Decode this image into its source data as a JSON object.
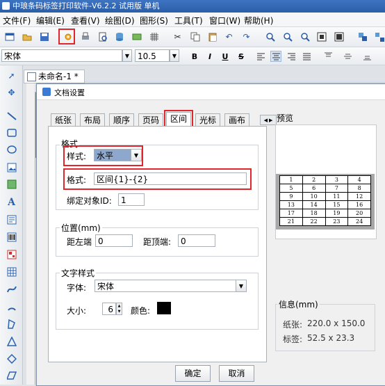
{
  "window": {
    "title": "中琅条码标签打印软件-V6.2.2 试用版 单机"
  },
  "menu": [
    "文件(F)",
    "编辑(E)",
    "查看(V)",
    "绘图(D)",
    "图形(S)",
    "工具(T)",
    "窗口(W)",
    "帮助(H)"
  ],
  "format_bar": {
    "font": "宋体",
    "size": "10.5",
    "bold": "B",
    "italic": "I",
    "underline": "U",
    "strike": "S"
  },
  "left_tools": {
    "text_tool": "A"
  },
  "document_tab": {
    "label": "未命名-1 *"
  },
  "dialog": {
    "title": "文档设置",
    "tabs": [
      "纸张",
      "布局",
      "顺序",
      "页码",
      "区间",
      "光标",
      "画布"
    ],
    "selected_tab": "区间",
    "format_group": {
      "title": "格式",
      "style_label": "样式:",
      "style_value": "水平",
      "format_label": "格式:",
      "format_value": "区间{1}-{2}",
      "bind_label": "绑定对象ID:",
      "bind_value": "1"
    },
    "position_group": {
      "title": "位置(mm)",
      "left_label": "距左端",
      "left_value": "0",
      "top_label": "距顶端:",
      "top_value": "0"
    },
    "text_style_group": {
      "title": "文字样式",
      "font_label": "字体:",
      "font_value": "宋体",
      "size_label": "大小:",
      "size_value": "6",
      "color_label": "颜色:",
      "color_value": "#000000"
    },
    "preview": {
      "title": "预览",
      "grid": [
        [
          "1",
          "2",
          "3",
          "4"
        ],
        [
          "5",
          "6",
          "7",
          "8"
        ],
        [
          "9",
          "10",
          "11",
          "12"
        ],
        [
          "13",
          "14",
          "15",
          "16"
        ],
        [
          "17",
          "18",
          "19",
          "20"
        ],
        [
          "21",
          "22",
          "23",
          "24"
        ]
      ]
    },
    "info": {
      "title": "信息(mm)",
      "paper_label": "纸张:",
      "paper_value": "220.0 x 150.0",
      "label_label": "标签:",
      "label_value": "52.5 x 23.3"
    },
    "ok_label": "确定",
    "cancel_label": "取消"
  },
  "colors": {
    "highlight": "#e0262b",
    "title_bar": "#2c5ea8",
    "swatch": "#000000"
  }
}
